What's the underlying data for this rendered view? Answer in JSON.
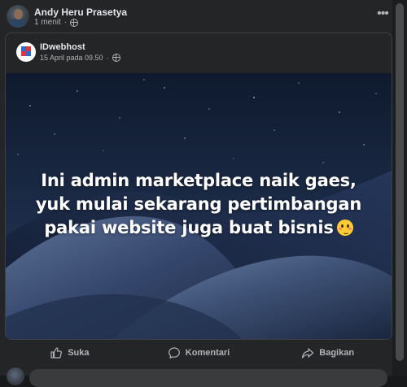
{
  "author": {
    "name": "Andy Heru Prasetya",
    "time": "1 menit",
    "separator": "·"
  },
  "shared_post": {
    "page_name": "IDwebhost",
    "date": "15 April pada 09.50",
    "separator": "·",
    "text": "Ini admin marketplace naik gaes, yuk mulai sekarang pertimbangan pakai website juga buat bisnis",
    "emoji": "smiling-face-with-tear"
  },
  "actions": {
    "like_label": "Suka",
    "comment_label": "Komentari",
    "share_label": "Bagikan"
  },
  "icons": {
    "more": "more-horizontal-icon",
    "privacy": "globe-icon",
    "like": "thumbs-up-icon",
    "comment": "comment-bubble-icon",
    "share": "share-arrow-icon"
  },
  "colors": {
    "background": "#242526",
    "text_primary": "#e4e6eb",
    "text_secondary": "#b0b3b8",
    "image_sky": "#182740"
  }
}
